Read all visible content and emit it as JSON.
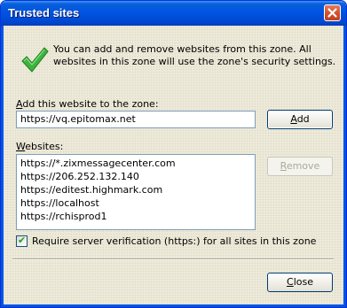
{
  "window": {
    "title": "Trusted sites",
    "frame_color": "#0054e3",
    "client_color": "#ece9d8"
  },
  "info": {
    "icon": "checkmark-icon",
    "text": "You can add and remove websites from this zone. All websites in this zone will use the zone's security settings."
  },
  "add_section": {
    "label": "Add this website to the zone:",
    "input_value": "https://vq.epitomax.net",
    "add_button": "Add"
  },
  "websites_section": {
    "label": "Websites:",
    "sites": [
      "https://*.zixmessagecenter.com",
      "https://206.252.132.140",
      "https://editest.highmark.com",
      "https://localhost",
      "https://rchisprod1"
    ],
    "remove_button": "Remove"
  },
  "verification": {
    "checked": true,
    "label": "Require server verification (https:) for all sites in this zone"
  },
  "footer": {
    "close_button": "Close"
  }
}
